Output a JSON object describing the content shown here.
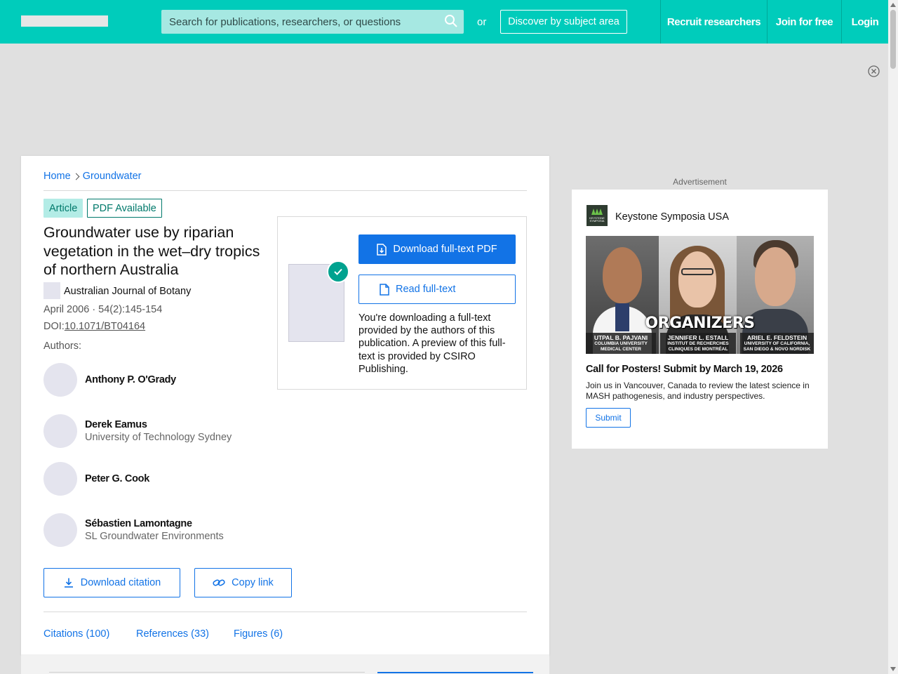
{
  "header": {
    "search_placeholder": "Search for publications, researchers, or questions",
    "or_label": "or",
    "discover_label": "Discover by subject area",
    "nav": {
      "recruit": "Recruit researchers",
      "join": "Join for free",
      "login": "Login"
    },
    "accent_color": "#00ccbb"
  },
  "breadcrumb": {
    "home": "Home",
    "topic": "Groundwater"
  },
  "article": {
    "type_badge": "Article",
    "pdf_badge": "PDF Available",
    "title": "Groundwater use by riparian vegetation in the wet–dry tropics of northern Australia",
    "journal": "Australian Journal of Botany",
    "date_line": "April 2006 · 54(2):145-154",
    "doi_prefix": "DOI:",
    "doi": "10.1071/BT04164",
    "authors_label": "Authors:",
    "authors": [
      {
        "name": "Anthony P. O'Grady",
        "affiliation": ""
      },
      {
        "name": "Derek Eamus",
        "affiliation": "University of Technology Sydney"
      },
      {
        "name": "Peter G. Cook",
        "affiliation": ""
      },
      {
        "name": "Sébastien Lamontagne",
        "affiliation": "SL Groundwater Environments"
      }
    ],
    "actions": {
      "download_citation": "Download citation",
      "copy_link": "Copy link"
    },
    "tabs": {
      "citations": "Citations (100)",
      "references": "References (33)",
      "figures": "Figures (6)"
    }
  },
  "download_panel": {
    "download_pdf": "Download full-text PDF",
    "read_fulltext": "Read full-text",
    "note": "You're downloading a full-text provided by the authors of this publication. A preview of this full-text is provided by CSIRO Publishing."
  },
  "ad": {
    "label": "Advertisement",
    "logo_text_1": "KEYSTONE",
    "logo_text_2": "SYMPOSIA",
    "brand": "Keystone Symposia USA",
    "image_heading": "ORGANIZERS",
    "organizers": [
      {
        "name": "UTPAL B. PAJVANI",
        "aff1": "COLUMBIA UNIVERSITY",
        "aff2": "MEDICAL CENTER"
      },
      {
        "name": "JENNIFER L. ESTALL",
        "aff1": "INSTITUT DE RECHERCHES",
        "aff2": "CLINIQUES DE MONTRÉAL"
      },
      {
        "name": "ARIEL E. FELDSTEIN",
        "aff1": "UNIVERSITY OF CALIFORNIA,",
        "aff2": "SAN DIEGO & NOVO NORDISK"
      }
    ],
    "headline": "Call for Posters! Submit by March 19, 2026",
    "body": "Join us in Vancouver, Canada to review the latest science in MASH pathogenesis, and industry perspectives.",
    "button": "Submit"
  }
}
